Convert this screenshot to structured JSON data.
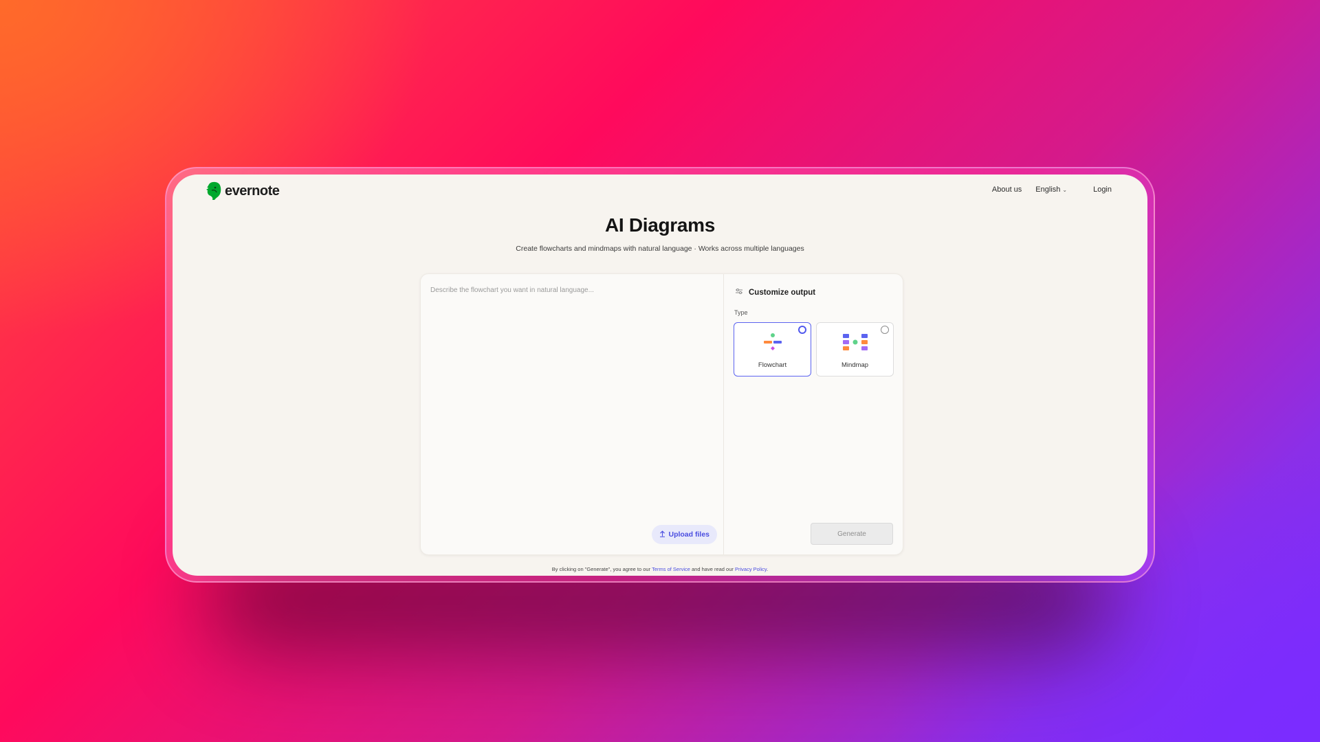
{
  "brand": {
    "name": "evernote",
    "color": "#00a82d"
  },
  "nav": {
    "about": "About us",
    "language": "English",
    "login": "Login"
  },
  "page": {
    "title": "AI Diagrams",
    "subtitle": "Create flowcharts and mindmaps with natural language · Works across multiple languages"
  },
  "prompt": {
    "placeholder": "Describe the flowchart you want in natural language...",
    "value": "",
    "upload_label": "Upload files"
  },
  "customize": {
    "heading": "Customize output",
    "type_label": "Type",
    "options": [
      {
        "label": "Flowchart",
        "selected": true,
        "icon": "flowchart-icon"
      },
      {
        "label": "Mindmap",
        "selected": false,
        "icon": "mindmap-icon"
      }
    ],
    "generate_label": "Generate"
  },
  "footer": {
    "prefix": "By clicking on \"Generate\", you agree to our",
    "terms": "Terms of Service",
    "middle": "and have read our",
    "privacy": "Privacy Policy",
    "suffix": "."
  },
  "colors": {
    "accent": "#4a4de0",
    "window_bg": "#f7f4ef"
  }
}
